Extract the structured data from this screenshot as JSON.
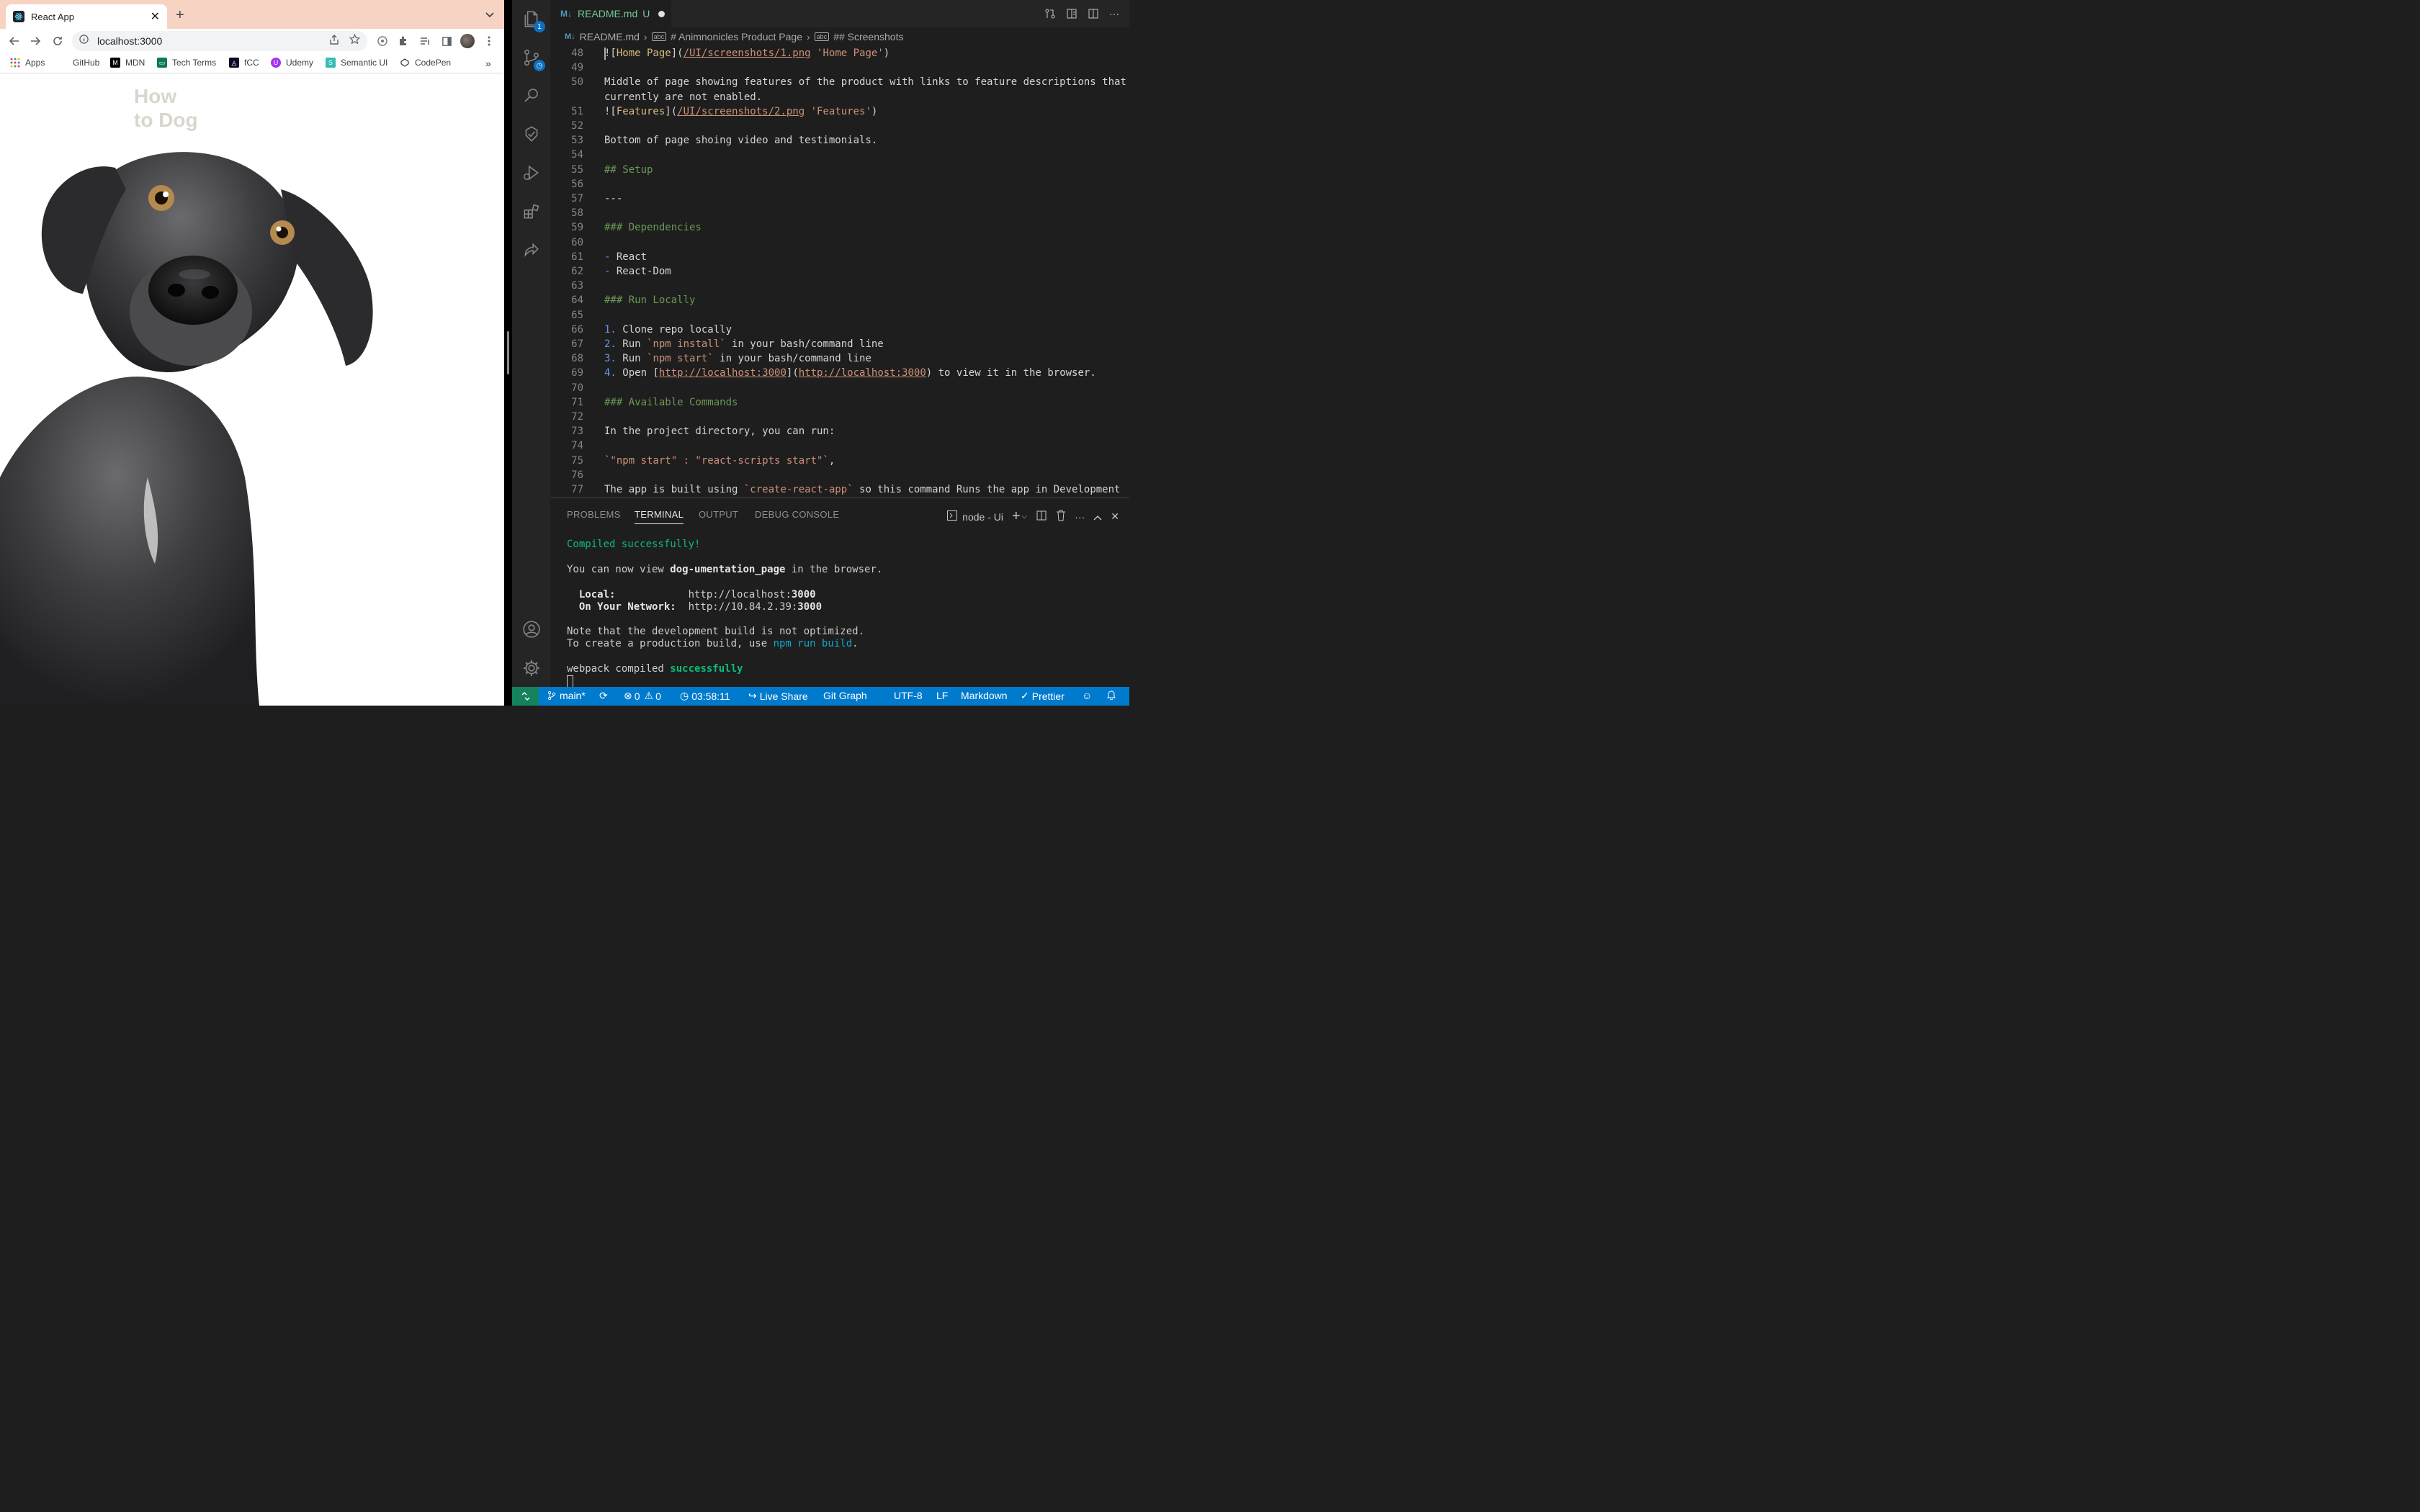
{
  "browser": {
    "tab_title": "React App",
    "address": "localhost:3000",
    "bookmarks": [
      "Apps",
      "GitHub",
      "MDN",
      "Tech Terms",
      "fCC",
      "Udemy",
      "Semantic UI",
      "CodePen"
    ],
    "bookmarks_more": "»",
    "page": {
      "title_line1": "How",
      "title_line2": "to Dog"
    }
  },
  "vscode": {
    "tab": {
      "label": "README.md",
      "status": "U",
      "icon": "markdown-icon"
    },
    "breadcrumb": [
      "README.md",
      "# Animnonicles Product Page",
      "## Screenshots"
    ],
    "activity_badge": "1",
    "editor_lines": [
      {
        "n": "48",
        "parts": [
          [
            "plain",
            "!["
          ],
          [
            "alt",
            "Home Page"
          ],
          [
            "plain",
            "]("
          ],
          [
            "link",
            "/UI/screenshots/1.png"
          ],
          [
            "plain",
            " "
          ],
          [
            "str",
            "'Home Page'"
          ],
          [
            "plain",
            ")"
          ]
        ]
      },
      {
        "n": "49",
        "parts": []
      },
      {
        "n": "50",
        "parts": [
          [
            "plain",
            "Middle of page showing features of the product with links to feature descriptions that"
          ]
        ]
      },
      {
        "n": "",
        "parts": [
          [
            "plain",
            "currently are not enabled."
          ]
        ]
      },
      {
        "n": "51",
        "parts": [
          [
            "plain",
            "!["
          ],
          [
            "alt",
            "Features"
          ],
          [
            "plain",
            "]("
          ],
          [
            "link",
            "/UI/screenshots/2.png"
          ],
          [
            "plain",
            " "
          ],
          [
            "str",
            "'Features'"
          ],
          [
            "plain",
            ")"
          ]
        ]
      },
      {
        "n": "52",
        "parts": []
      },
      {
        "n": "53",
        "parts": [
          [
            "plain",
            "Bottom of page shoing video and testimonials."
          ]
        ]
      },
      {
        "n": "54",
        "parts": []
      },
      {
        "n": "55",
        "parts": [
          [
            "head",
            "## Setup"
          ]
        ]
      },
      {
        "n": "56",
        "parts": []
      },
      {
        "n": "57",
        "parts": [
          [
            "plain",
            "---"
          ]
        ]
      },
      {
        "n": "58",
        "parts": []
      },
      {
        "n": "59",
        "parts": [
          [
            "head",
            "### Dependencies"
          ]
        ]
      },
      {
        "n": "60",
        "parts": []
      },
      {
        "n": "61",
        "parts": [
          [
            "list",
            "- "
          ],
          [
            "plain",
            "React"
          ]
        ]
      },
      {
        "n": "62",
        "parts": [
          [
            "list",
            "- "
          ],
          [
            "plain",
            "React-Dom"
          ]
        ]
      },
      {
        "n": "63",
        "parts": []
      },
      {
        "n": "64",
        "parts": [
          [
            "head",
            "### Run Locally"
          ]
        ]
      },
      {
        "n": "65",
        "parts": []
      },
      {
        "n": "66",
        "parts": [
          [
            "list",
            "1. "
          ],
          [
            "plain",
            "Clone repo locally"
          ]
        ]
      },
      {
        "n": "67",
        "parts": [
          [
            "list",
            "2. "
          ],
          [
            "plain",
            "Run "
          ],
          [
            "code",
            "`npm install`"
          ],
          [
            "plain",
            " in your bash/command line"
          ]
        ]
      },
      {
        "n": "68",
        "parts": [
          [
            "list",
            "3. "
          ],
          [
            "plain",
            "Run "
          ],
          [
            "code",
            "`npm start`"
          ],
          [
            "plain",
            " in your bash/command line"
          ]
        ]
      },
      {
        "n": "69",
        "parts": [
          [
            "list",
            "4. "
          ],
          [
            "plain",
            "Open ["
          ],
          [
            "link",
            "http://localhost:3000"
          ],
          [
            "plain",
            "]("
          ],
          [
            "link",
            "http://localhost:3000"
          ],
          [
            "plain",
            ") to view it in the browser."
          ]
        ]
      },
      {
        "n": "70",
        "parts": []
      },
      {
        "n": "71",
        "parts": [
          [
            "head",
            "### Available Commands"
          ]
        ]
      },
      {
        "n": "72",
        "parts": []
      },
      {
        "n": "73",
        "parts": [
          [
            "plain",
            "In the project directory, you can run:"
          ]
        ]
      },
      {
        "n": "74",
        "parts": []
      },
      {
        "n": "75",
        "parts": [
          [
            "code",
            "`\"npm start\" : \"react-scripts start\"`"
          ],
          [
            "plain",
            ","
          ]
        ]
      },
      {
        "n": "76",
        "parts": []
      },
      {
        "n": "77",
        "parts": [
          [
            "plain",
            "The app is built using "
          ],
          [
            "code",
            "`create-react-app`"
          ],
          [
            "plain",
            " so this command Runs the app in Development"
          ]
        ]
      }
    ],
    "panel": {
      "tabs": [
        "PROBLEMS",
        "TERMINAL",
        "OUTPUT",
        "DEBUG CONSOLE"
      ],
      "active_tab": "TERMINAL",
      "terminal_name": "node - Ui",
      "lines": {
        "compiled": "Compiled successfully!",
        "view_prefix": "You can now view ",
        "view_app": "dog-umentation_page",
        "view_suffix": " in the browser.",
        "local_label": "  Local:            ",
        "local_url_base": "http://localhost:",
        "local_port": "3000",
        "net_label": "  On Your Network:  ",
        "net_url_base": "http://10.84.2.39:",
        "net_port": "3000",
        "note1": "Note that the development build is not optimized.",
        "note2_prefix": "To create a production build, use ",
        "note2_cmd": "npm run build",
        "note2_suffix": ".",
        "webpack_prefix": "webpack compiled ",
        "webpack_status": "successfully"
      }
    },
    "statusbar": {
      "branch": "main*",
      "errors": "0",
      "warnings": "0",
      "time": "03:58:11",
      "live_share": "Live Share",
      "git_graph": "Git Graph",
      "encoding": "UTF-8",
      "eol": "LF",
      "language": "Markdown",
      "formatter": "Prettier"
    }
  },
  "colors": {
    "tabstrip": "#f6d3c2",
    "statusbar": "#007acc",
    "heading": "#6a9955",
    "string": "#ce9178",
    "terminal_green": "#0dbc79"
  }
}
